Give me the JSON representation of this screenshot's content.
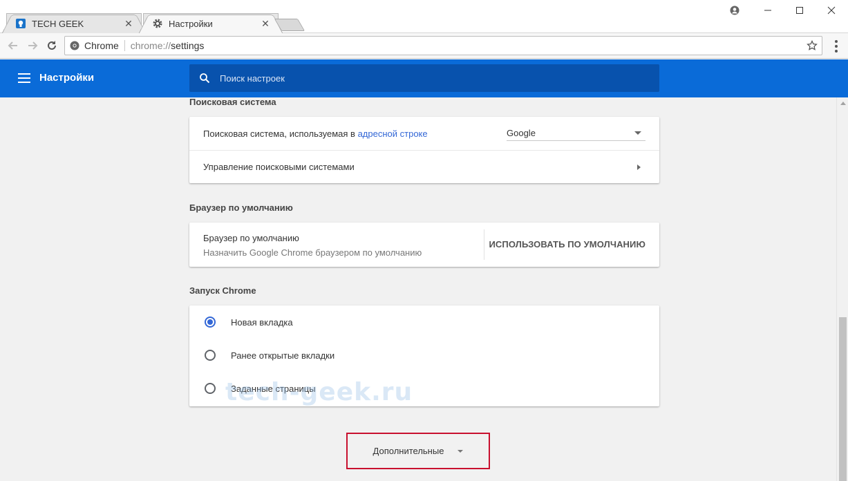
{
  "tabs": [
    {
      "title": "TECH GEEK",
      "icon": "lightbulb-icon"
    },
    {
      "title": "Настройки",
      "icon": "gear-icon"
    }
  ],
  "toolbar": {
    "site_name": "Chrome",
    "url_scheme": "chrome://",
    "url_path": "settings"
  },
  "header": {
    "title": "Настройки",
    "search_placeholder": "Поиск настроек"
  },
  "search_engine": {
    "section_title": "Поисковая система",
    "row1_prefix": "Поисковая система, используемая в ",
    "row1_link": "адресной строке",
    "selected_engine": "Google",
    "row2_label": "Управление поисковыми системами"
  },
  "default_browser": {
    "section_title": "Браузер по умолчанию",
    "primary": "Браузер по умолчанию",
    "secondary": "Назначить Google Chrome браузером по умолчанию",
    "button": "ИСПОЛЬЗОВАТЬ ПО УМОЛЧАНИЮ"
  },
  "startup": {
    "section_title": "Запуск Chrome",
    "options": [
      {
        "label": "Новая вкладка",
        "checked": true
      },
      {
        "label": "Ранее открытые вкладки",
        "checked": false
      },
      {
        "label": "Заданные страницы",
        "checked": false
      }
    ]
  },
  "watermark": "tech-geek.ru",
  "advanced": {
    "label": "Дополнительные"
  },
  "colors": {
    "header": "#0a6bd8",
    "search_bg": "#0852ad",
    "link": "#3367d6",
    "highlight": "#c8102e"
  }
}
